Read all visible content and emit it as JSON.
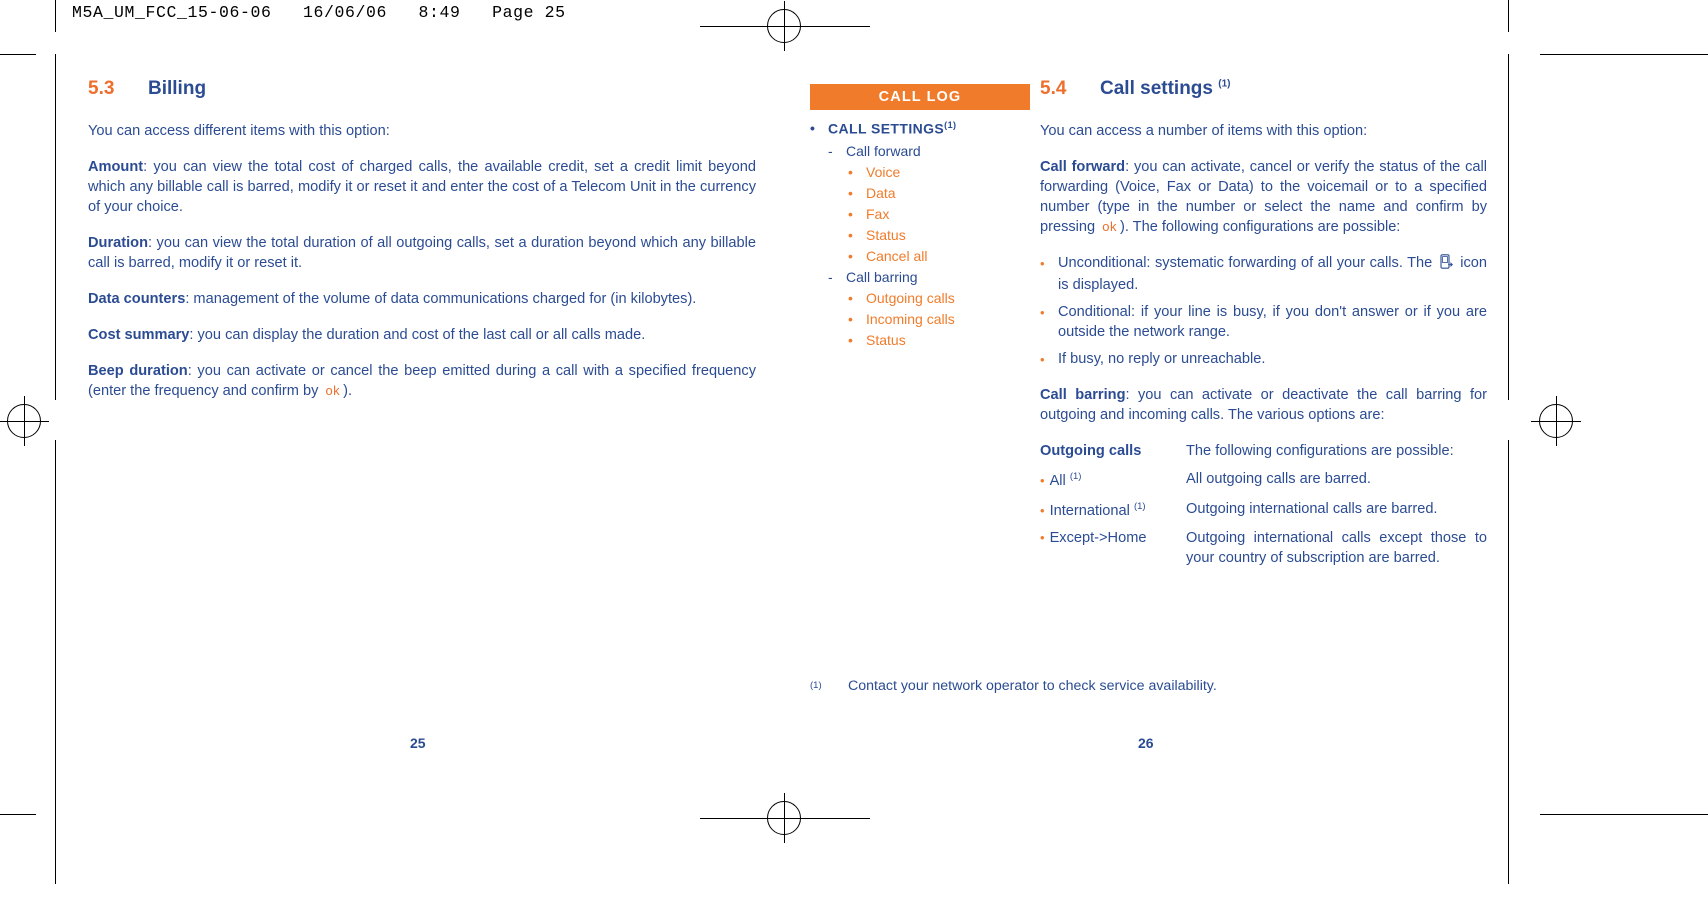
{
  "file_stamp": "M5A_UM_FCC_15-06-06   16/06/06   8:49   Page 25",
  "colors": {
    "orange": "#F07C2B",
    "heading_orange": "#EE6F2D",
    "blue": "#2B4C93",
    "white": "#FFFFFF"
  },
  "left_page": {
    "section_number": "5.3",
    "section_title": "Billing",
    "intro": "You can access different items with this option:",
    "entries": [
      {
        "term": "Amount",
        "text": ": you can view the total cost of charged calls, the available credit, set a credit limit beyond which any billable call is barred, modify it or reset it and enter the cost of a Telecom Unit in the currency of your choice."
      },
      {
        "term": "Duration",
        "text": ": you can view the total duration of all outgoing calls, set a duration beyond which any billable call is barred, modify it or reset it."
      },
      {
        "term": "Data counters",
        "text": ": management of the volume of data communications charged for (in kilobytes)."
      },
      {
        "term": "Cost summary",
        "text": ": you can display the duration and cost of the last call or all calls made."
      }
    ],
    "beep": {
      "term": "Beep duration",
      "text_before": ": you can activate or cancel the beep emitted during a call with a specified frequency (enter the frequency and confirm by ",
      "ok_key": "ok",
      "text_after": ")."
    },
    "page_number": "25"
  },
  "right_page": {
    "banner": "CALL LOG",
    "tree": {
      "root": "CALL SETTINGS",
      "root_footnote": "(1)",
      "groups": [
        {
          "label": "Call forward",
          "items": [
            "Voice",
            "Data",
            "Fax",
            "Status",
            "Cancel all"
          ]
        },
        {
          "label": "Call barring",
          "items": [
            "Outgoing calls",
            "Incoming calls",
            "Status"
          ]
        }
      ]
    },
    "section_number": "5.4",
    "section_title": "Call settings",
    "section_title_footnote": "(1)",
    "intro": "You can access a number of items with this option:",
    "call_forward": {
      "term": "Call forward",
      "text_before": ": you can activate, cancel or verify the status of the call forwarding (Voice, Fax or Data) to the voicemail or to a specified number (type in the number or select the name and confirm by pressing ",
      "ok_key": "ok",
      "text_after": "). The following configurations are possible:",
      "options": [
        {
          "text_before": "Unconditional: systematic forwarding of all your calls. The ",
          "icon": "call-forward-icon",
          "text_after": " icon is displayed."
        },
        {
          "text_before": "Conditional: if your line is busy, if you don't answer or if you are outside the network range.",
          "icon": null,
          "text_after": ""
        },
        {
          "text_before": "If busy, no reply or unreachable.",
          "icon": null,
          "text_after": ""
        }
      ]
    },
    "call_barring": {
      "term": "Call barring",
      "text": ": you can activate or deactivate the call barring for outgoing and incoming calls. The various options are:",
      "table_header": {
        "term": "Outgoing calls",
        "desc": "The following configurations are possible:"
      },
      "rows": [
        {
          "term": "All",
          "footnote": "(1)",
          "desc": "All outgoing calls are barred."
        },
        {
          "term": "International",
          "footnote": "(1)",
          "desc": "Outgoing international calls are barred."
        },
        {
          "term": "Except->Home",
          "footnote": "",
          "desc": "Outgoing international calls except those to your country of subscription are barred."
        }
      ]
    },
    "footnote": {
      "mark": "(1)",
      "text": "Contact your network operator to check service availability."
    },
    "page_number": "26"
  }
}
